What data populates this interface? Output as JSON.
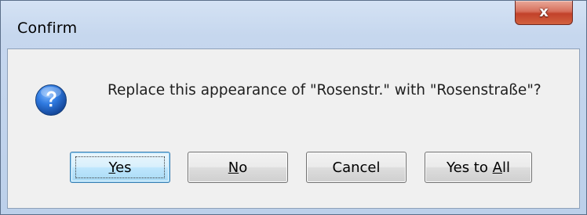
{
  "window": {
    "title": "Confirm",
    "close_glyph": "x",
    "close_icon": "close-icon"
  },
  "message": {
    "icon": "question-icon",
    "text": "Replace this appearance of \"Rosenstr.\" with \"Rosenstraße\"?"
  },
  "buttons": {
    "yes": {
      "pre": "",
      "key": "Y",
      "post": "es",
      "default": true
    },
    "no": {
      "pre": "",
      "key": "N",
      "post": "o"
    },
    "cancel": {
      "label": "Cancel"
    },
    "yes_to_all": {
      "pre": "Yes to ",
      "key": "A",
      "post": "ll"
    }
  },
  "colors": {
    "accent": "#3c7fb1",
    "close_red": "#c2412a",
    "icon_blue": "#1f5fb8"
  }
}
